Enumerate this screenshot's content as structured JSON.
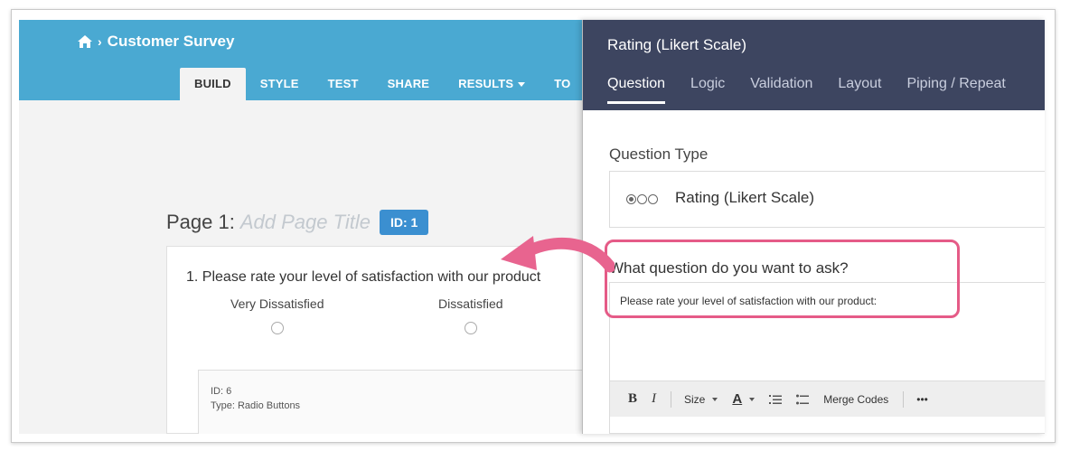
{
  "builder": {
    "breadcrumb": "Customer Survey",
    "tabs": [
      {
        "label": "BUILD"
      },
      {
        "label": "STYLE"
      },
      {
        "label": "TEST"
      },
      {
        "label": "SHARE"
      },
      {
        "label": "RESULTS"
      },
      {
        "label": "TO"
      }
    ],
    "page": {
      "prefix": "Page 1:",
      "title_placeholder": "Add Page Title",
      "id_badge": "ID: 1"
    },
    "question": {
      "text": "1. Please rate your level of satisfaction with our product",
      "options": [
        "Very Dissatisfied",
        "Dissatisfied"
      ],
      "meta_id": "ID: 6",
      "meta_type": "Type: Radio Buttons"
    }
  },
  "panel": {
    "title": "Rating (Likert Scale)",
    "tabs": [
      "Question",
      "Logic",
      "Validation",
      "Layout",
      "Piping / Repeat"
    ],
    "question_type_label": "Question Type",
    "question_type_value": "Rating (Likert Scale)",
    "ask_label": "What question do you want to ask?",
    "ask_value": "Please rate your level of satisfaction with our product:",
    "toolbar": {
      "bold": "B",
      "italic": "I",
      "size": "Size",
      "font_color": "A",
      "merge_codes": "Merge Codes",
      "more": "•••"
    }
  },
  "colors": {
    "builder_header": "#4aa9d2",
    "panel_header": "#3d4560",
    "highlight": "#e55b87",
    "badge": "#3b8fd0"
  }
}
